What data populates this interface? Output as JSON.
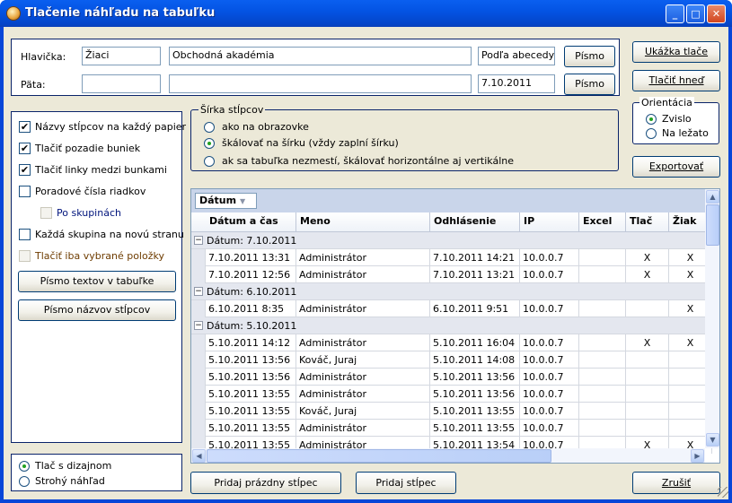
{
  "window": {
    "title": "Tlačenie náhľadu na tabuľku"
  },
  "header_footer": {
    "header_label": "Hlavička:",
    "header_field1": "Žiaci",
    "header_field2": "Obchodná akadémia",
    "header_field3": "Podľa abecedy",
    "header_font_button": "Písmo",
    "footer_label": "Päta:",
    "footer_field1": "",
    "footer_field2": "",
    "footer_field3": "7.10.2011",
    "footer_font_button": "Písmo"
  },
  "right_buttons": {
    "preview": "Ukážka tlače",
    "print_now": "Tlačiť hneď",
    "export": "Exportovať",
    "cancel": "Zrušiť"
  },
  "orientation": {
    "legend": "Orientácia",
    "options": [
      "Zvislo",
      "Na ležato"
    ],
    "selected": 0
  },
  "column_width": {
    "legend": "Šírka stĺpcov",
    "options": [
      "ako na obrazovke",
      "škálovať na šírku (vždy zaplní šírku)",
      "ak sa tabuľka nezmestí, škálovať horizontálne aj vertikálne"
    ],
    "selected": 1
  },
  "options_panel": {
    "items": [
      {
        "label": "Názvy stĺpcov na každý papier",
        "checked": true
      },
      {
        "label": "Tlačiť pozadie buniek",
        "checked": true
      },
      {
        "label": "Tlačiť linky medzi bunkami",
        "checked": true
      },
      {
        "label": "Poradové čísla riadkov",
        "checked": false
      },
      {
        "label": "Po skupinách",
        "checked": false,
        "disabled": true
      },
      {
        "label": "Každá skupina na novú stranu",
        "checked": false
      },
      {
        "label": "Tlačiť iba vybrané položky",
        "checked": false
      }
    ],
    "font_table_button": "Písmo textov v tabuľke",
    "font_headers_button": "Písmo názvov stĺpcov"
  },
  "print_mode": {
    "options": [
      "Tlač s dizajnom",
      "Strohý náhľad"
    ],
    "selected": 0
  },
  "grid": {
    "group_chip": "Dátum",
    "columns": [
      "Dátum a čas",
      "Meno",
      "Odhlásenie",
      "IP",
      "Excel",
      "Tlač",
      "Žiak"
    ],
    "groups": [
      {
        "label": "Dátum:  7.10.2011",
        "rows": [
          [
            "7.10.2011 13:31",
            "Administrátor",
            "7.10.2011 14:21",
            "10.0.0.7",
            "",
            "X",
            "X"
          ],
          [
            "7.10.2011 12:56",
            "Administrátor",
            "7.10.2011 13:21",
            "10.0.0.7",
            "",
            "X",
            "X"
          ]
        ]
      },
      {
        "label": "Dátum:  6.10.2011",
        "rows": [
          [
            "6.10.2011 8:35",
            "Administrátor",
            "6.10.2011 9:51",
            "10.0.0.7",
            "",
            "",
            "X"
          ]
        ]
      },
      {
        "label": "Dátum:  5.10.2011",
        "rows": [
          [
            "5.10.2011 14:12",
            "Administrátor",
            "5.10.2011 16:04",
            "10.0.0.7",
            "",
            "X",
            "X"
          ],
          [
            "5.10.2011 13:56",
            "Kováč, Juraj",
            "5.10.2011 14:08",
            "10.0.0.7",
            "",
            "",
            ""
          ],
          [
            "5.10.2011 13:56",
            "Administrátor",
            "5.10.2011 13:56",
            "10.0.0.7",
            "",
            "",
            ""
          ],
          [
            "5.10.2011 13:55",
            "Administrátor",
            "5.10.2011 13:56",
            "10.0.0.7",
            "",
            "",
            ""
          ],
          [
            "5.10.2011 13:55",
            "Kováč, Juraj",
            "5.10.2011 13:55",
            "10.0.0.7",
            "",
            "",
            ""
          ],
          [
            "5.10.2011 13:55",
            "Administrátor",
            "5.10.2011 13:55",
            "10.0.0.7",
            "",
            "",
            ""
          ],
          [
            "5.10.2011 13:55",
            "Administrátor",
            "5.10.2011 13:54",
            "10.0.0.7",
            "",
            "X",
            "X"
          ]
        ]
      }
    ]
  },
  "bottom_buttons": {
    "add_empty_column": "Pridaj prázdny stĺpec",
    "add_column": "Pridaj stĺpec"
  }
}
